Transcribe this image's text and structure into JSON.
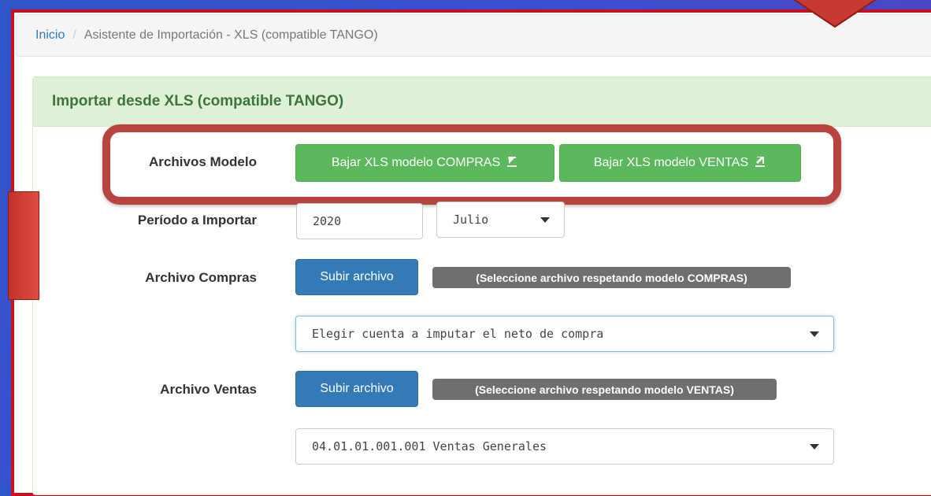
{
  "breadcrumb": {
    "home": "Inicio",
    "separator": "/",
    "current": "Asistente de Importación - XLS (compatible TANGO)"
  },
  "panel": {
    "title": "Importar desde XLS (compatible TANGO)"
  },
  "form": {
    "archivos_modelo": {
      "label": "Archivos Modelo",
      "btn_compras": "Bajar XLS modelo COMPRAS",
      "btn_ventas": "Bajar XLS modelo VENTAS",
      "download_icon": "download-icon"
    },
    "periodo": {
      "label": "Período a Importar",
      "year": "2020",
      "month": "Julio"
    },
    "compras": {
      "label": "Archivo Compras",
      "upload_button": "Subir archivo",
      "hint": "(Seleccione archivo respetando modelo COMPRAS)",
      "account_select": "Elegir cuenta a imputar el neto de compra"
    },
    "ventas": {
      "label": "Archivo Ventas",
      "upload_button": "Subir archivo",
      "hint": "(Seleccione archivo respetando modelo VENTAS)",
      "account_select": "04.01.01.001.001 Ventas Generales"
    }
  },
  "colors": {
    "highlight": "#b8443d",
    "frame": "#c9101d",
    "green": "#5cb85c",
    "blue": "#337ab7"
  }
}
